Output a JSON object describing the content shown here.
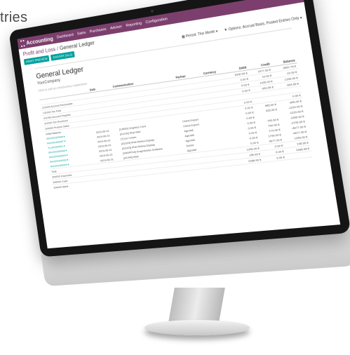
{
  "background_text": "tries",
  "app": {
    "name": "Accounting",
    "menu": [
      "Dashboard",
      "Sales",
      "Purchases",
      "Adviser",
      "Reporting",
      "Configuration"
    ]
  },
  "breadcrumb": {
    "parent": "Profit and Loss",
    "current": "General Ledger"
  },
  "toolbar": {
    "buttons": [
      "PRINT PREVIEW",
      "EXPORT (XLS)"
    ],
    "period": "Period: This Month",
    "options": "Options: Accrual Basis, Posted Entries Only"
  },
  "report": {
    "title": "General Ledger",
    "company": "YourCompany",
    "intro": "Click to add an introductory explanation"
  },
  "table": {
    "headers": [
      "",
      "Date",
      "Communication",
      "Partner",
      "Currency",
      "Debit",
      "Credit",
      "Balance"
    ],
    "rows": [
      [
        "",
        "",
        "",
        "",
        "",
        "5330.00 €",
        "2477.50 €",
        "2852.75 €"
      ],
      [
        "121000 Account Receivable",
        "",
        "",
        "",
        "",
        "0.00 €",
        "10.00 €",
        "-10.00 €"
      ],
      [
        "131000 Tax Paid",
        "",
        "",
        "",
        "",
        "0.00 €",
        "1335.00 €",
        "-1335.00 €"
      ],
      [
        "211000 Account Payable",
        "",
        "",
        "",
        "",
        "0.00 €",
        "653.55 €",
        "-653.55 €"
      ],
      [
        "112000 Tax Received",
        "",
        "",
        "",
        "",
        "",
        "",
        ""
      ],
      [
        "200000 Product Sales",
        "",
        "",
        "",
        "",
        "0.00 €",
        "",
        "0.00 €"
      ],
      [
        "Initial Balance",
        "",
        "",
        "",
        "",
        "0.00 €",
        "985.00 €",
        "-895.00 €"
      ],
      [
        "INV/2015/0006 ▾",
        "2015-06-01",
        "[CARD] Graphics Card",
        "China Export",
        "",
        "0.00 €",
        "325.00 €",
        "-1220.00 €"
      ],
      [
        "INV/2015/0007 ▾",
        "2015-06-01",
        "[A1232] iPad Mini",
        "China Export",
        "",
        "0.00 €",
        "",
        "-1220.00 €"
      ],
      [
        "TL/2015/0001 ▾",
        "2015-06-01",
        "[?] Ice Cream",
        "Agrolait",
        "",
        "0.00 €",
        "750.00 €",
        "-1955.00 €"
      ],
      [
        "INV/2015/0008 ▾",
        "2015-06-01",
        "[A2323] iPad Retina Display",
        "Agrolait",
        "",
        "0.00 €",
        "750.00 €",
        "-2705.00 €"
      ],
      [
        "INV/2015/0009 ▾",
        "2015-06-01",
        "[A2323] iPad Retina Display",
        "Agrolait",
        "",
        "0.00 €",
        "173.00 €",
        "-4677.00 €"
      ],
      [
        "INV/2015/0003 ▾",
        "2015-06-01",
        "[SRAPPoil] GraphWorks Software",
        "Axelor",
        "",
        "0.00 €",
        "1799.00 €",
        "-4677.00 €"
      ],
      [
        "INV/2015/0004 ▾",
        "2015-06-01",
        "[A1090] iMac",
        "Agrolait",
        "",
        "0.00 €",
        "4677.00 €",
        "1335.00 €"
      ],
      [
        "Total",
        "",
        "",
        "",
        "",
        "1335.00 €",
        "0.00 €",
        "198.95 €"
      ],
      [
        "200000 Expenses",
        "",
        "",
        "",
        "",
        "198.95 €",
        "0.00 €",
        "2288.95 €"
      ],
      [
        "390000 Cash",
        "",
        "",
        "",
        "",
        "2288.95 €",
        "0.00 €",
        ""
      ],
      [
        "300000 Bank",
        "",
        "",
        "",
        "",
        "",
        "",
        ""
      ]
    ]
  }
}
